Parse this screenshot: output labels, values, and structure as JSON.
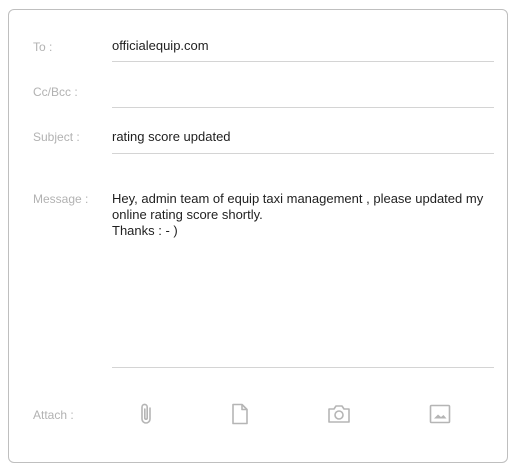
{
  "compose": {
    "to": {
      "label": "To :",
      "value": "officialequip.com"
    },
    "cc": {
      "label": "Cc/Bcc :",
      "value": ""
    },
    "subject": {
      "label": "Subject :",
      "value": "rating score updated"
    },
    "message": {
      "label": "Message :",
      "lines": [
        "Hey, admin team of equip taxi management , please updated my online rating score shortly.",
        "Thanks : - )"
      ]
    },
    "attach": {
      "label": "Attach :",
      "icons": [
        "paperclip-icon",
        "file-icon",
        "camera-icon",
        "image-icon"
      ]
    }
  },
  "colors": {
    "label": "#b2b2b2",
    "text": "#1f1f1f",
    "divider": "#d4d4d4",
    "border": "#bfbfbf",
    "icon": "#b5b5b5"
  }
}
